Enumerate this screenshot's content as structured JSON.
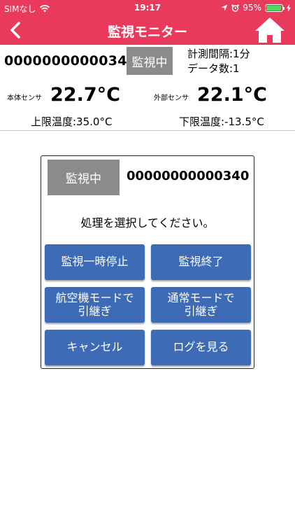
{
  "status_bar": {
    "carrier": "SIMなし",
    "time": "19:17",
    "battery_percent": "95%",
    "battery_level": 0.95,
    "color": "#ea3a5c"
  },
  "nav": {
    "title": "監視モニター",
    "back_icon": "chevron-left-icon",
    "home_icon": "home-icon"
  },
  "device": {
    "id": "00000000000340",
    "status": "監視中",
    "interval": "計測間隔:1分",
    "data_count": "データ数:1"
  },
  "sensors": {
    "internal_label": "本体センサ",
    "internal_value": "22.7°C",
    "external_label": "外部センサ",
    "external_value": "22.1°C",
    "upper_limit": "上限温度:35.0°C",
    "lower_limit": "下限温度:-13.5°C"
  },
  "dialog": {
    "status": "監視中",
    "id": "00000000000340",
    "prompt": "処理を選択してください。",
    "buttons": {
      "pause": "監視一時停止",
      "end": "監視終了",
      "airplane_handover": "航空機モードで\n引継ぎ",
      "normal_handover": "通常モードで\n引継ぎ",
      "cancel": "キャンセル",
      "view_log": "ログを見る"
    },
    "button_color": "#3d6bb5"
  }
}
